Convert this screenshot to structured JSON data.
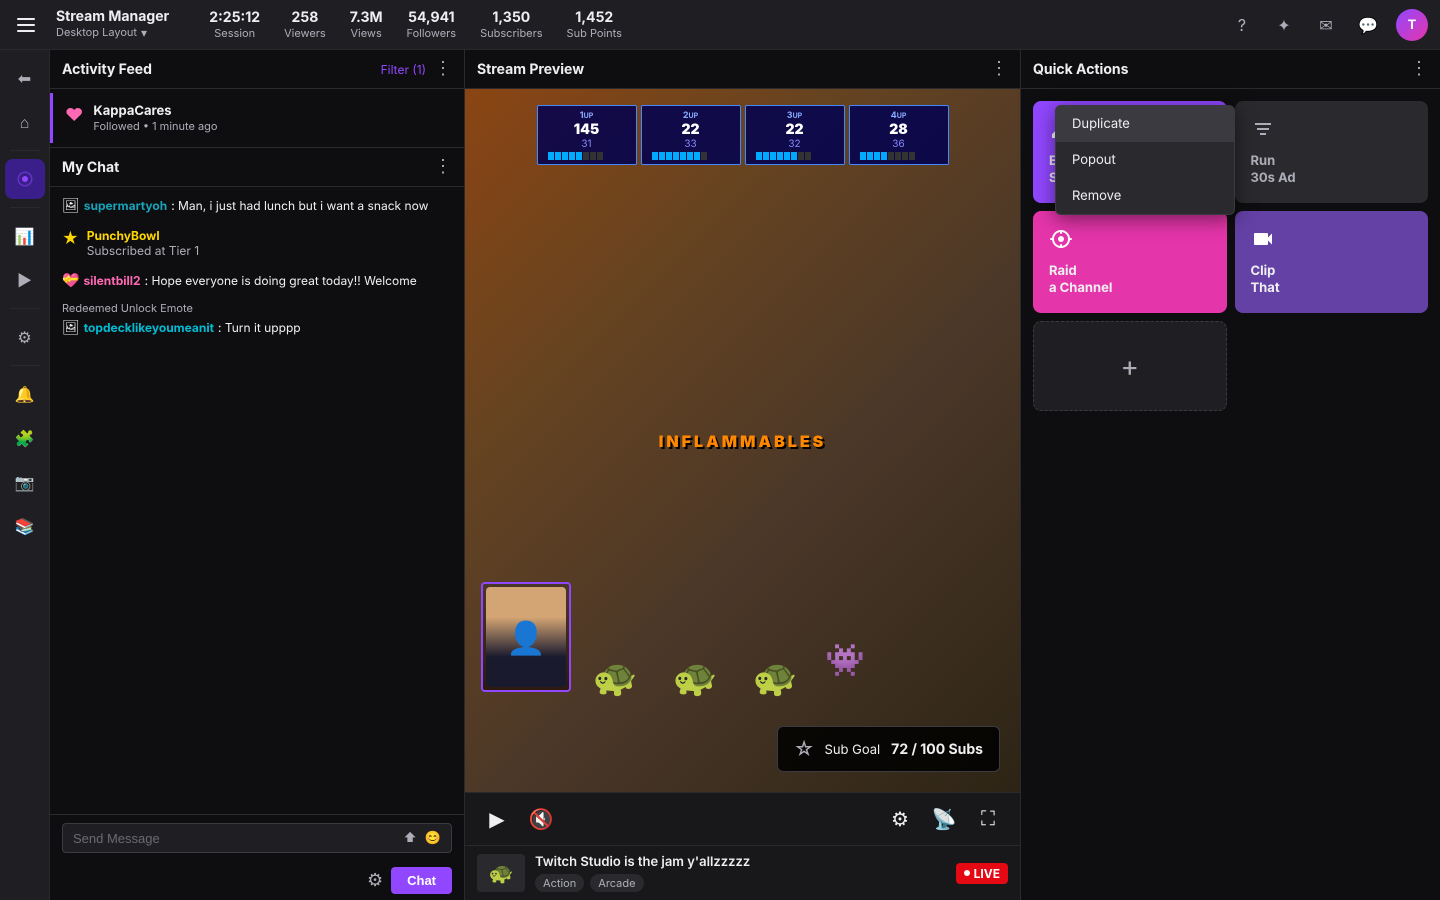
{
  "app": {
    "title": "Stream Manager",
    "subtitle": "Desktop Layout"
  },
  "nav": {
    "stats": [
      {
        "value": "2:25:12",
        "label": "Session"
      },
      {
        "value": "258",
        "label": "Viewers"
      },
      {
        "value": "7.3M",
        "label": "Views"
      },
      {
        "value": "54,941",
        "label": "Followers"
      },
      {
        "value": "1,350",
        "label": "Subscribers"
      },
      {
        "value": "1,452",
        "label": "Sub Points"
      }
    ]
  },
  "activity_feed": {
    "title": "Activity Feed",
    "filter_label": "Filter (1)",
    "items": [
      {
        "name": "KappaCares",
        "detail": "Followed • 1 minute ago"
      }
    ]
  },
  "chat": {
    "title": "My Chat",
    "messages": [
      {
        "user": "supermartyoh",
        "color": "blue",
        "text": "Man, i just had lunch but i want a snack now"
      },
      {
        "user": "PunchyBowl",
        "color": "star",
        "event": "Subscribed at Tier 1"
      },
      {
        "user": "silentbill2",
        "color": "pink",
        "text": "Hope everyone is doing great today!! Welcome"
      },
      {
        "redeem": "Redeemed Unlock Emote",
        "user": "topdecklikeyoumeanit",
        "color": "cyan",
        "text": "Turn it upppp"
      }
    ],
    "input_placeholder": "Send Message",
    "send_label": "Chat"
  },
  "stream_preview": {
    "title": "Stream Preview",
    "game_title": "Twitch Studio is the jam y'allzzzzz",
    "tags": [
      "Action",
      "Arcade"
    ],
    "live": "LIVE",
    "sub_goal": {
      "label": "Sub Goal",
      "current": "72",
      "target": "100 Subs"
    },
    "scoreboard": [
      {
        "player": "1UP",
        "score": "145",
        "sub": "31",
        "bars": [
          1,
          1,
          1,
          1,
          1,
          0,
          0,
          0
        ]
      },
      {
        "player": "2UP",
        "score": "22",
        "sub": "33",
        "bars": [
          1,
          1,
          1,
          1,
          1,
          1,
          1,
          0
        ]
      },
      {
        "player": "3UP",
        "score": "22",
        "sub": "32",
        "bars": [
          1,
          1,
          1,
          1,
          1,
          1,
          0,
          0
        ]
      },
      {
        "player": "4UP",
        "score": "28",
        "sub": "36",
        "bars": [
          1,
          1,
          1,
          1,
          0,
          0,
          0,
          0
        ]
      }
    ],
    "stage_label": "INFLAMMABLES"
  },
  "dropdown": {
    "items": [
      "Duplicate",
      "Popout",
      "Remove"
    ]
  },
  "quick_actions": {
    "title": "Quick Actions",
    "cards": [
      {
        "id": "edit-stream-info",
        "label": "Edit\nStream Info",
        "color": "purple",
        "icon": "✏️"
      },
      {
        "id": "run-ad",
        "label": "Run\n30s Ad",
        "color": "gray",
        "icon": "▶"
      },
      {
        "id": "raid-channel",
        "label": "Raid\na Channel",
        "color": "pink",
        "icon": "🎯"
      },
      {
        "id": "clip-that",
        "label": "Clip\nThat",
        "color": "dark-purple",
        "icon": "🎬"
      },
      {
        "id": "add-action",
        "label": "+",
        "color": "add",
        "icon": "+"
      }
    ]
  }
}
